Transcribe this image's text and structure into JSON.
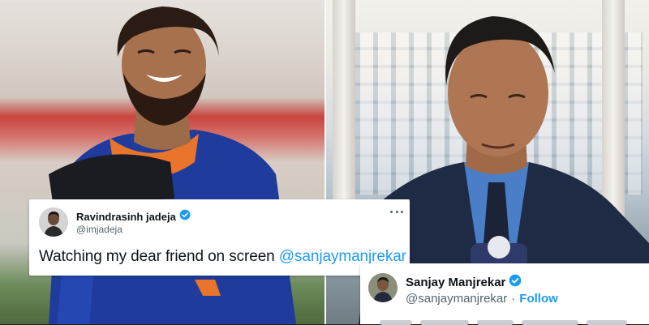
{
  "left_tweet": {
    "display_name": "Ravindrasinh jadeja",
    "handle": "@imjadeja",
    "text_prefix": "Watching my dear friend on screen ",
    "mention": "@sanjaymanjrekar"
  },
  "right_tweet": {
    "display_name": "Sanjay Manjrekar",
    "handle": "@sanjaymanjrekar",
    "separator": "·",
    "follow_label": "Follow"
  },
  "colors": {
    "link_blue": "#1d9bf0",
    "text_primary": "#0f1419",
    "text_secondary": "#536471",
    "jersey_blue": "#1f3c9c"
  },
  "icons": {
    "verified": "verified-badge-icon",
    "more": "more-options-icon"
  }
}
